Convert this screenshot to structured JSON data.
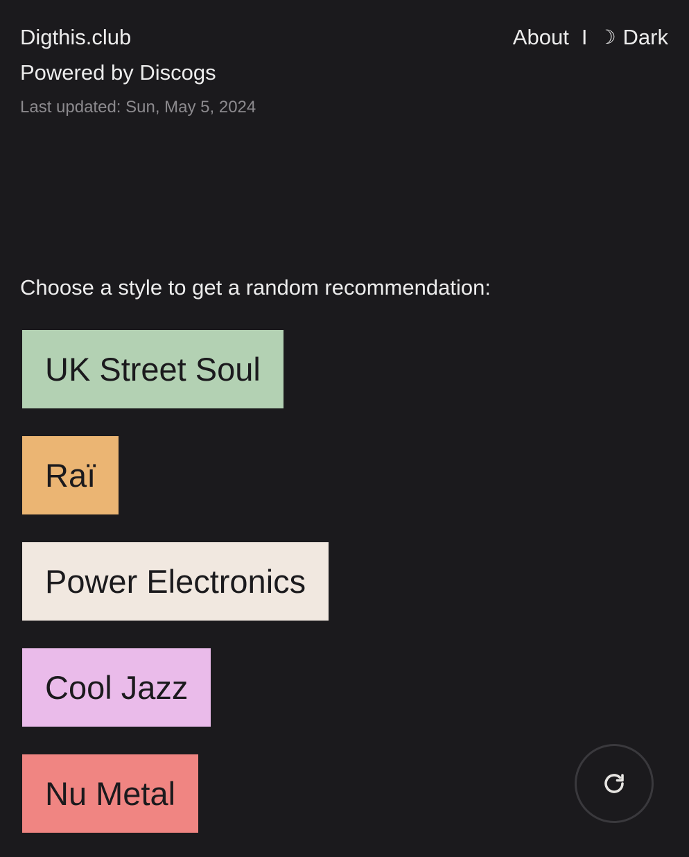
{
  "header": {
    "site_title": "Digthis.club",
    "powered_by": "Powered by Discogs",
    "last_updated": "Last updated: Sun, May 5, 2024"
  },
  "nav": {
    "about": "About",
    "separator": "I",
    "theme_icon": "☽",
    "theme_label": "Dark"
  },
  "prompt": "Choose a style to get a random recommendation:",
  "styles": [
    {
      "label": "UK Street Soul",
      "color": "#b3d1b3"
    },
    {
      "label": "Raï",
      "color": "#ebb573"
    },
    {
      "label": "Power Electronics",
      "color": "#f1e8e0"
    },
    {
      "label": "Cool Jazz",
      "color": "#eabbea"
    },
    {
      "label": "Nu Metal",
      "color": "#f08582"
    }
  ],
  "refresh": {
    "icon": "refresh-icon"
  }
}
